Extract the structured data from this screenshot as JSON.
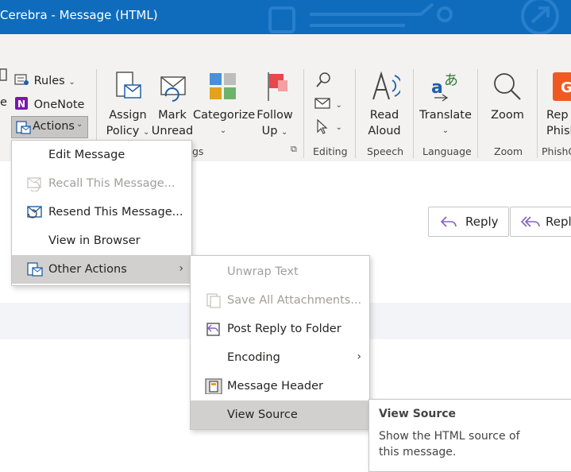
{
  "window": {
    "title": "Cerebra  -  Message (HTML)"
  },
  "ribbon": {
    "small_buttons": {
      "rules": "Rules",
      "onenote": "OneNote",
      "actions": "Actions"
    },
    "cut_letter": "e",
    "assign_policy": [
      "Assign",
      "Policy"
    ],
    "mark_unread": [
      "Mark",
      "Unread"
    ],
    "categorize": "Categorize",
    "follow_up": [
      "Follow",
      "Up"
    ],
    "tags_label_partial": "gs",
    "editing_label": "Editing",
    "read_aloud": [
      "Read",
      "Aloud"
    ],
    "speech_label": "Speech",
    "translate": "Translate",
    "language_label": "Language",
    "zoom": "Zoom",
    "zoom_label": "Zoom",
    "report_phish": [
      "Rep",
      "Phish"
    ],
    "phishg_label": "PhishG"
  },
  "reading": {
    "reply": "Reply",
    "reply_all_partial": "Reply"
  },
  "actions_menu": {
    "items": [
      {
        "label": "Edit Message",
        "disabled": false
      },
      {
        "label": "Recall This Message...",
        "disabled": true
      },
      {
        "label": "Resend This Message...",
        "disabled": false
      },
      {
        "label": "View in Browser",
        "disabled": false
      },
      {
        "label": "Other Actions",
        "disabled": false,
        "highlighted": true,
        "submenu": true
      }
    ]
  },
  "other_actions_menu": {
    "items": [
      {
        "label": "Unwrap Text",
        "disabled": true
      },
      {
        "label": "Save All Attachments...",
        "disabled": true
      },
      {
        "label": "Post Reply to Folder",
        "disabled": false
      },
      {
        "label": "Encoding",
        "disabled": false,
        "submenu": true
      },
      {
        "label": "Message Header",
        "disabled": false
      },
      {
        "label": "View Source",
        "disabled": false,
        "highlighted": true
      }
    ]
  },
  "tooltip": {
    "title": "View Source",
    "body": "Show the HTML source of this message."
  },
  "colors": {
    "titlebar": "#0f6cbd",
    "ribbon": "#f3f2f1",
    "highlight": "#d2d0ce",
    "accent": "#1f5fa8"
  }
}
